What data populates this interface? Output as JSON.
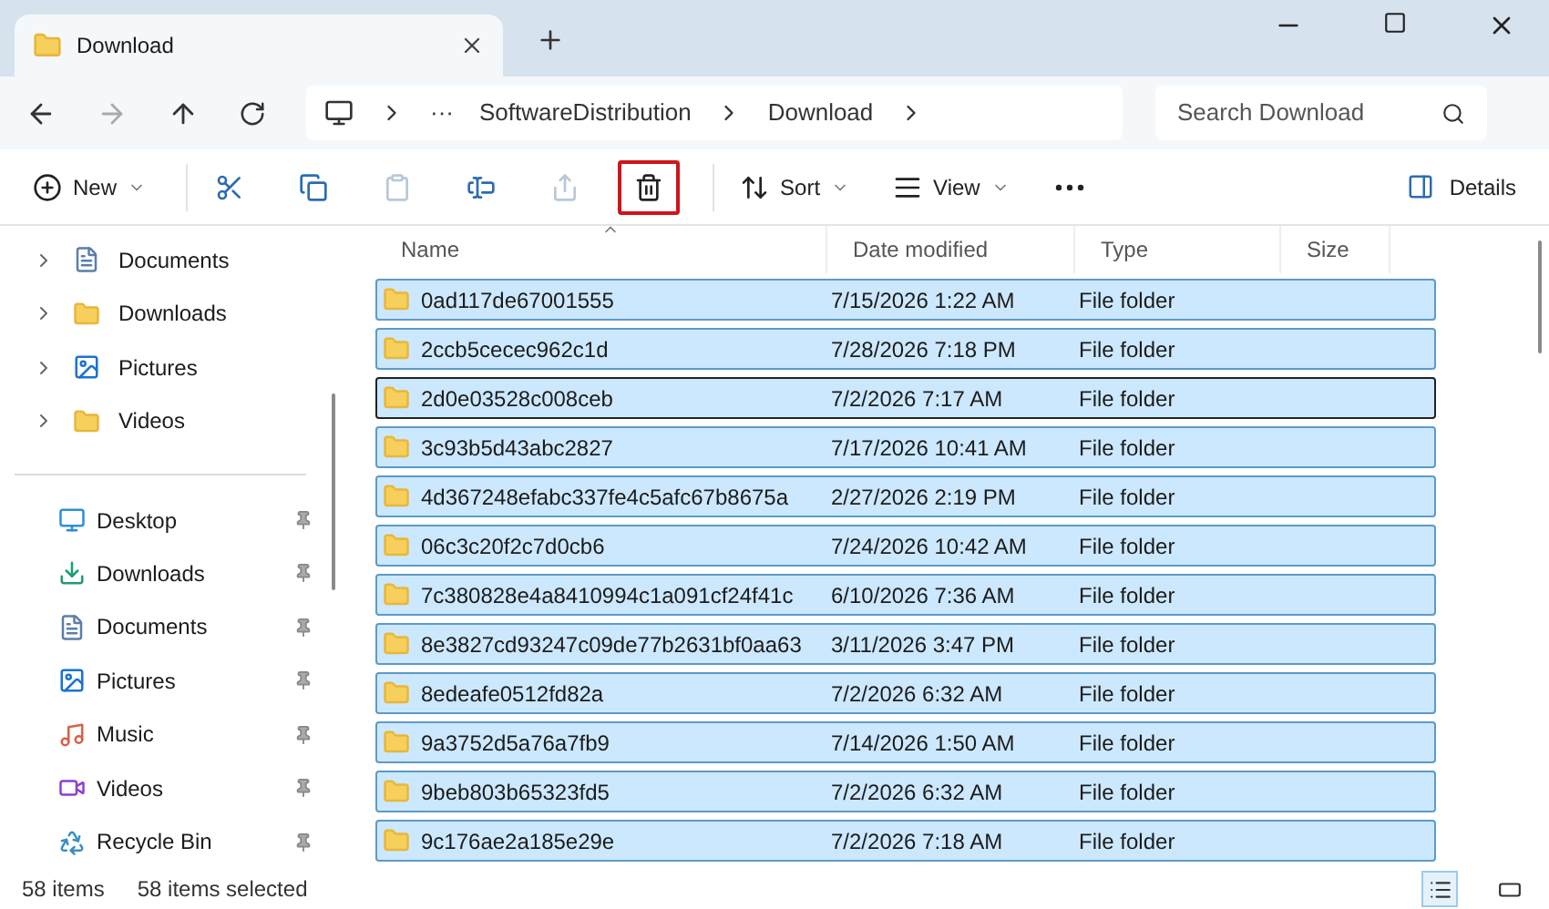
{
  "tab": {
    "title": "Download",
    "selected": true
  },
  "address": {
    "overflow": "···",
    "crumbs": [
      "SoftwareDistribution",
      "Download"
    ]
  },
  "search": {
    "placeholder": "Search Download"
  },
  "toolbar": {
    "left": [
      {
        "label": "New",
        "dropdown": true,
        "disabled": false,
        "highlighted": false
      },
      {
        "disabled": false,
        "highlighted": false
      },
      {
        "disabled": false,
        "highlighted": false
      },
      {
        "disabled": true,
        "highlighted": false
      },
      {
        "disabled": false,
        "highlighted": false
      },
      {
        "disabled": true,
        "highlighted": false
      },
      {
        "disabled": false,
        "highlighted": true
      },
      {
        "label": "Sort",
        "dropdown": true,
        "disabled": false,
        "highlighted": false
      },
      {
        "label": "View",
        "dropdown": true,
        "disabled": false,
        "highlighted": false
      },
      {
        "disabled": false,
        "highlighted": false
      }
    ],
    "details": {
      "label": "Details"
    }
  },
  "sidebar": {
    "tree": [
      {
        "label": "Documents",
        "expanded": false
      },
      {
        "label": "Downloads",
        "expanded": false
      },
      {
        "label": "Pictures",
        "expanded": false
      },
      {
        "label": "Videos",
        "expanded": false
      }
    ],
    "quick_access": [
      {
        "label": "Desktop",
        "pinned": true
      },
      {
        "label": "Downloads",
        "pinned": true
      },
      {
        "label": "Documents",
        "pinned": true
      },
      {
        "label": "Pictures",
        "pinned": true
      },
      {
        "label": "Music",
        "pinned": true
      },
      {
        "label": "Videos",
        "pinned": true
      },
      {
        "label": "Recycle Bin",
        "pinned": true
      }
    ]
  },
  "table": {
    "columns": [
      {
        "label": "Name",
        "sorted": true
      },
      {
        "label": "Date modified",
        "sorted": false
      },
      {
        "label": "Type",
        "sorted": false
      },
      {
        "label": "Size",
        "sorted": false
      }
    ],
    "rows": [
      {
        "name": "0ad117de67001555",
        "date": "7/15/2026 1:22 AM",
        "type": "File folder",
        "selected": true,
        "focused": false
      },
      {
        "name": "2ccb5cecec962c1d",
        "date": "7/28/2026 7:18 PM",
        "type": "File folder",
        "selected": true,
        "focused": false
      },
      {
        "name": "2d0e03528c008ceb",
        "date": "7/2/2026 7:17 AM",
        "type": "File folder",
        "selected": true,
        "focused": true
      },
      {
        "name": "3c93b5d43abc2827",
        "date": "7/17/2026 10:41 AM",
        "type": "File folder",
        "selected": true,
        "focused": false
      },
      {
        "name": "4d367248efabc337fe4c5afc67b8675a",
        "date": "2/27/2026 2:19 PM",
        "type": "File folder",
        "selected": true,
        "focused": false
      },
      {
        "name": "06c3c20f2c7d0cb6",
        "date": "7/24/2026 10:42 AM",
        "type": "File folder",
        "selected": true,
        "focused": false
      },
      {
        "name": "7c380828e4a8410994c1a091cf24f41c",
        "date": "6/10/2026 7:36 AM",
        "type": "File folder",
        "selected": true,
        "focused": false
      },
      {
        "name": "8e3827cd93247c09de77b2631bf0aa63",
        "date": "3/11/2026 3:47 PM",
        "type": "File folder",
        "selected": true,
        "focused": false
      },
      {
        "name": "8edeafe0512fd82a",
        "date": "7/2/2026 6:32 AM",
        "type": "File folder",
        "selected": true,
        "focused": false
      },
      {
        "name": "9a3752d5a76a7fb9",
        "date": "7/14/2026 1:50 AM",
        "type": "File folder",
        "selected": true,
        "focused": false
      },
      {
        "name": "9beb803b65323fd5",
        "date": "7/2/2026 6:32 AM",
        "type": "File folder",
        "selected": true,
        "focused": false
      },
      {
        "name": "9c176ae2a185e29e",
        "date": "7/2/2026 7:18 AM",
        "type": "File folder",
        "selected": true,
        "focused": false
      }
    ]
  },
  "status_bar": {
    "count": "58 items",
    "selection": "58 items selected"
  },
  "view_toggle": [
    {
      "selected": true
    },
    {
      "selected": false
    }
  ]
}
